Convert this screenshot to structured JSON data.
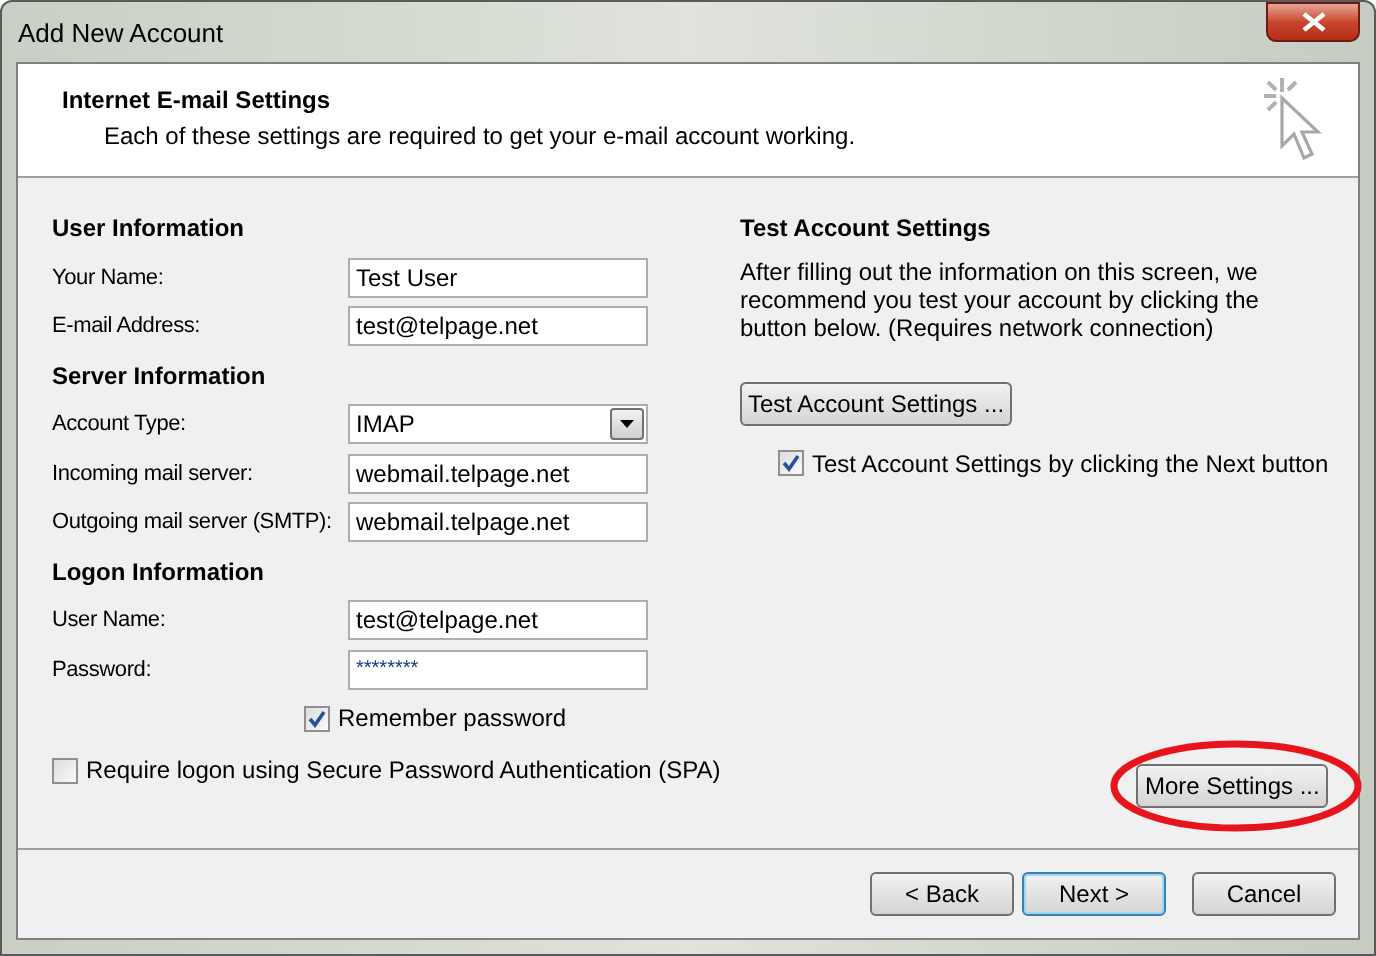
{
  "window": {
    "title": "Add New Account"
  },
  "header": {
    "title": "Internet E-mail Settings",
    "subtitle": "Each of these settings are required to get your e-mail account working."
  },
  "groups": [
    {
      "heading": "User Information",
      "fields": [
        {
          "kind": "text",
          "label": "Your Name:",
          "value": "Test User"
        },
        {
          "kind": "text",
          "label": "E-mail Address:",
          "value": "test@telpage.net"
        }
      ]
    },
    {
      "heading": "Server Information",
      "fields": [
        {
          "kind": "dropdown",
          "label": "Account Type:",
          "value": "IMAP"
        },
        {
          "kind": "text",
          "label": "Incoming mail server:",
          "value": "webmail.telpage.net"
        },
        {
          "kind": "text",
          "label": "Outgoing mail server (SMTP):",
          "value": "webmail.telpage.net"
        }
      ]
    },
    {
      "heading": "Logon Information",
      "fields": [
        {
          "kind": "text",
          "label": "User Name:",
          "value": "test@telpage.net"
        },
        {
          "kind": "password",
          "label": "Password:",
          "value": "********"
        }
      ]
    }
  ],
  "remember_password": {
    "label": "Remember password",
    "checked": true
  },
  "spa": {
    "label": "Require logon using Secure Password Authentication (SPA)",
    "checked": false
  },
  "test": {
    "heading": "Test Account Settings",
    "description": "After filling out the information on this screen, we recommend you test your account by clicking the button below. (Requires network connection)",
    "button": "Test Account Settings ...",
    "on_next": {
      "label": "Test Account Settings by clicking the Next button",
      "checked": true
    }
  },
  "more_settings": {
    "label": "More Settings ...",
    "highlighted": true
  },
  "footer": [
    {
      "label": "< Back",
      "focused": false
    },
    {
      "label": "Next >",
      "focused": true
    },
    {
      "label": "Cancel",
      "focused": false
    }
  ]
}
